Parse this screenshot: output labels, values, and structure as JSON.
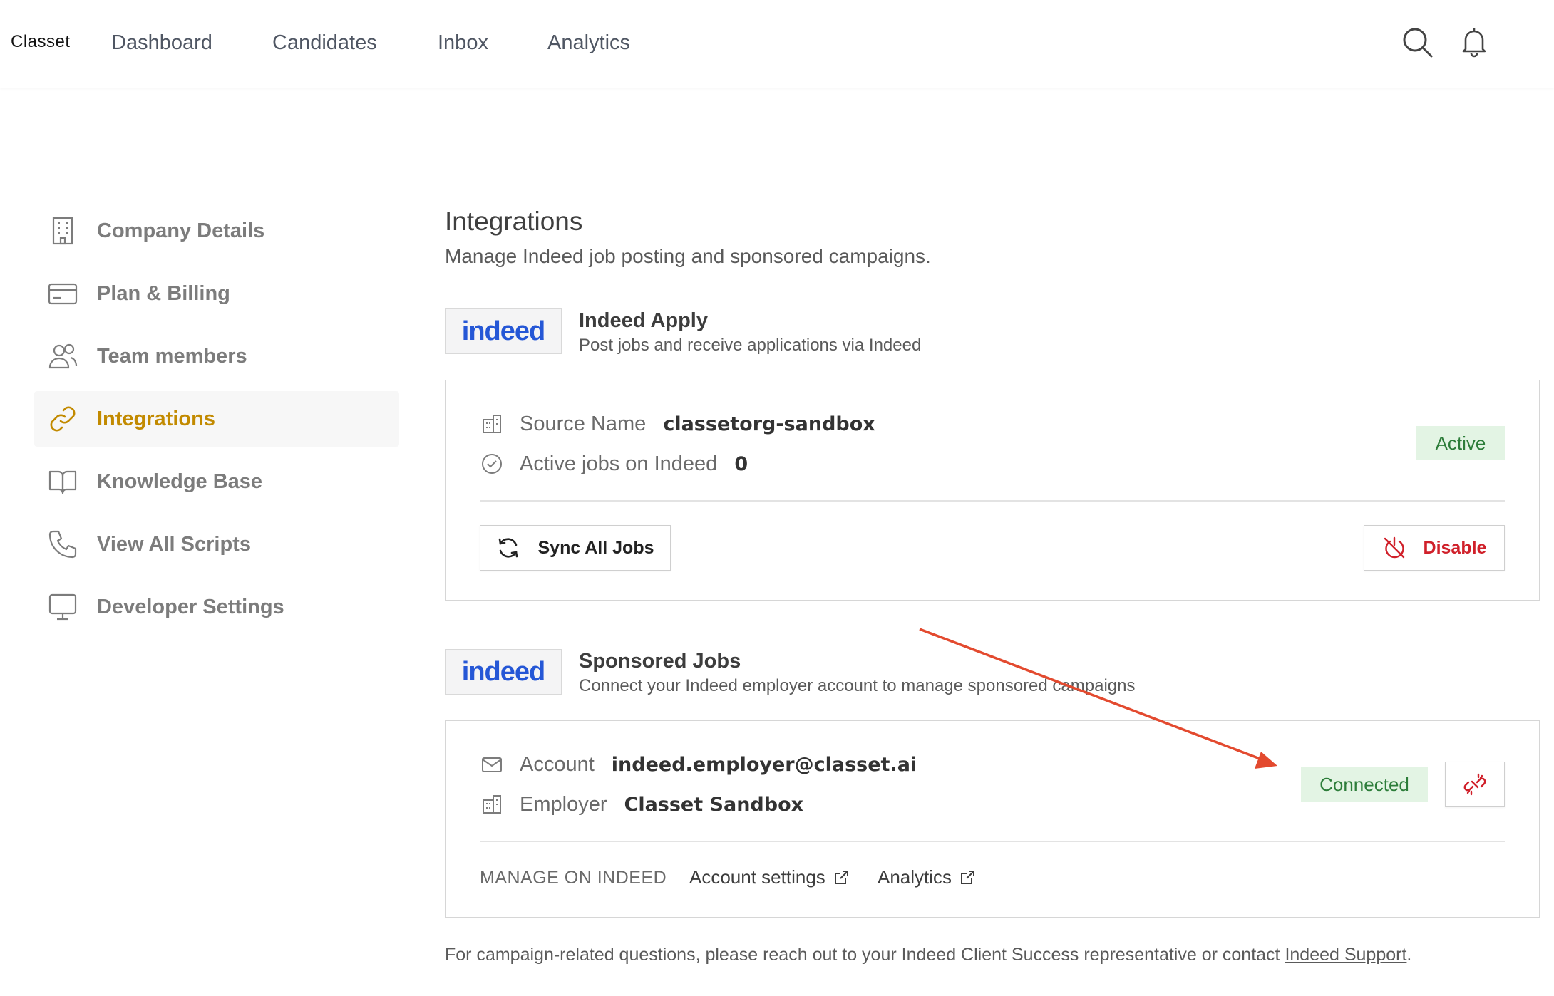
{
  "header": {
    "brand": "Classet",
    "nav": [
      "Dashboard",
      "Candidates",
      "Inbox",
      "Analytics"
    ],
    "icons": [
      "search-icon",
      "bell-icon"
    ]
  },
  "sidebar": {
    "items": [
      {
        "label": "Company Details",
        "icon": "building-icon",
        "active": false
      },
      {
        "label": "Plan & Billing",
        "icon": "credit-card-icon",
        "active": false
      },
      {
        "label": "Team members",
        "icon": "users-icon",
        "active": false
      },
      {
        "label": "Integrations",
        "icon": "link-icon",
        "active": true
      },
      {
        "label": "Knowledge Base",
        "icon": "book-icon",
        "active": false
      },
      {
        "label": "View All Scripts",
        "icon": "phone-icon",
        "active": false
      },
      {
        "label": "Developer Settings",
        "icon": "monitor-icon",
        "active": false
      }
    ],
    "accent_color": "#c28a00"
  },
  "main": {
    "title": "Integrations",
    "subtitle": "Manage Indeed job posting and sponsored campaigns.",
    "indeed_apply": {
      "logo_text": "indeed",
      "title": "Indeed Apply",
      "subtitle": "Post jobs and receive applications via Indeed",
      "source_label": "Source Name",
      "source_value": "classetorg-sandbox",
      "jobs_label": "Active jobs on Indeed",
      "jobs_value": "0",
      "status": "Active",
      "sync_label": "Sync All Jobs",
      "disable_label": "Disable"
    },
    "sponsored_jobs": {
      "logo_text": "indeed",
      "title": "Sponsored Jobs",
      "subtitle": "Connect your Indeed employer account to manage sponsored campaigns",
      "account_label": "Account",
      "account_value": "indeed.employer@classet.ai",
      "employer_label": "Employer",
      "employer_value": "Classet Sandbox",
      "status": "Connected",
      "manage_label": "MANAGE ON INDEED",
      "links": [
        "Account settings",
        "Analytics"
      ]
    },
    "footer_text": "For campaign-related questions, please reach out to your Indeed Client Success representative or contact ",
    "footer_link": "Indeed Support",
    "footer_end": "."
  },
  "colors": {
    "success_bg": "#e3f4e4",
    "success_text": "#2d7d3a",
    "danger": "#d0202a",
    "indeed_blue": "#2557d6",
    "annotation_arrow": "#e34a2f"
  }
}
